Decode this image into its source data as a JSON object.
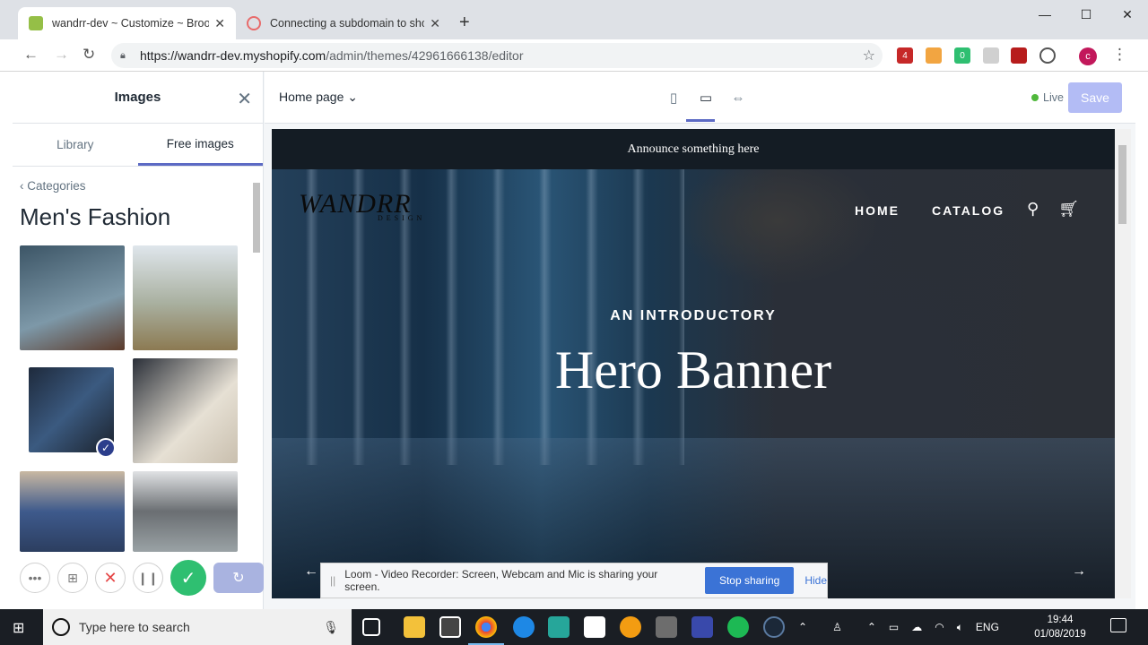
{
  "browser": {
    "tabs": [
      {
        "title": "wandrr-dev ~ Customize ~ Brooklyn",
        "favicon_color": "#95bf47"
      },
      {
        "title": "Connecting a subdomain to shopify",
        "favicon_color": "#e86b6b"
      }
    ],
    "new_tab": "+",
    "window": {
      "minimize": "—",
      "maximize": "☐",
      "close": "✕"
    },
    "url_host": "https://wandrr-dev.myshopify.com",
    "url_path": "/admin/themes/42961666138/editor",
    "profile_initial": "c"
  },
  "sidebar": {
    "title": "Images",
    "close_icon": "✕",
    "tabs": [
      "Library",
      "Free images"
    ],
    "active_tab": "Free images",
    "back_label": "Categories",
    "category_title": "Men's Fashion",
    "thumbnails": [
      {
        "color": "#5d7a8a",
        "selected": false
      },
      {
        "color": "#a9b0a0",
        "selected": false
      },
      {
        "color": "#2b3c55",
        "selected": true
      },
      {
        "color": "#d9d2c6",
        "selected": false
      },
      {
        "color": "#7f92a6",
        "selected": false
      },
      {
        "color": "#9aa2a5",
        "selected": false
      }
    ]
  },
  "loom_controls": {
    "more": "•••",
    "cam": "⊞",
    "cancel": "✕",
    "pause": "❙❙",
    "done": "✓",
    "restart": "↻"
  },
  "toolbar": {
    "page_selector": "Home page",
    "status": "Live",
    "save_label": "Save"
  },
  "preview": {
    "announcement": "Announce something here",
    "logo": "WANDRR",
    "logo_sub": "DESIGN",
    "nav": [
      "HOME",
      "CATALOG"
    ],
    "intro": "AN INTRODUCTORY",
    "hero_title": "Hero Banner",
    "prev_arrow": "←",
    "next_arrow": "→"
  },
  "loom_banner": {
    "message": "Loom - Video Recorder: Screen, Webcam and Mic is sharing your screen.",
    "stop_label": "Stop sharing",
    "hide_label": "Hide"
  },
  "taskbar": {
    "search_placeholder": "Type here to search",
    "language": "ENG",
    "time": "19:44",
    "date": "01/08/2019"
  }
}
